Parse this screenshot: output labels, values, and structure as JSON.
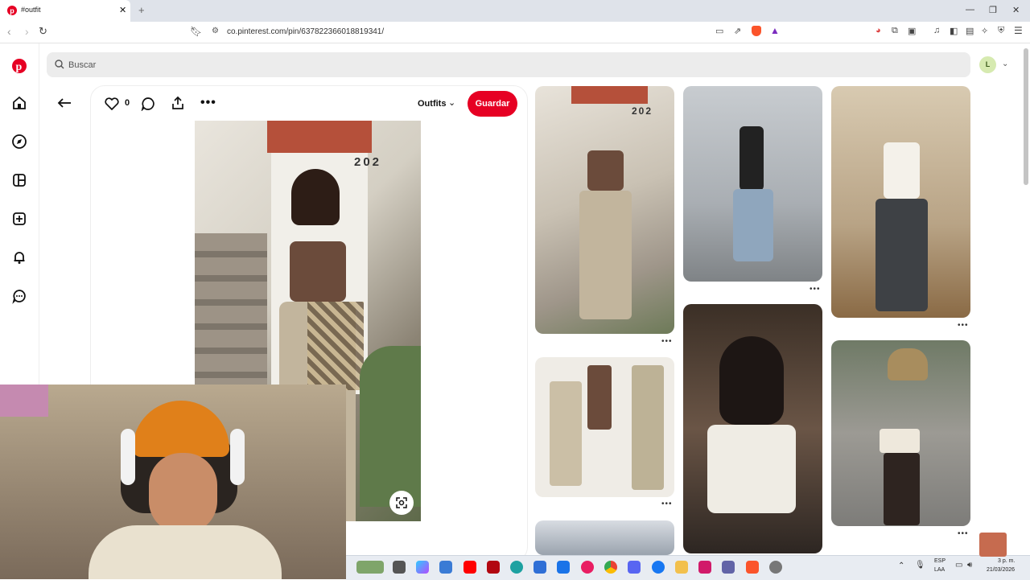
{
  "browser": {
    "tab_title": "#outfit",
    "url": "co.pinterest.com/pin/637822366018819341/"
  },
  "search": {
    "placeholder": "Buscar"
  },
  "avatar": {
    "initial": "L"
  },
  "pin": {
    "like_count": "0",
    "board": "Outfits",
    "save_label": "Guardar",
    "image_text": "202"
  },
  "grid_images": {
    "pin_b_text": "202"
  },
  "taskbar": {
    "lang_top": "ESP",
    "lang_bottom": "LAA",
    "time": "3 p. m.",
    "date": "21/03/2026"
  },
  "colors": {
    "accent": "#e60023",
    "search_bg": "#ececec"
  }
}
